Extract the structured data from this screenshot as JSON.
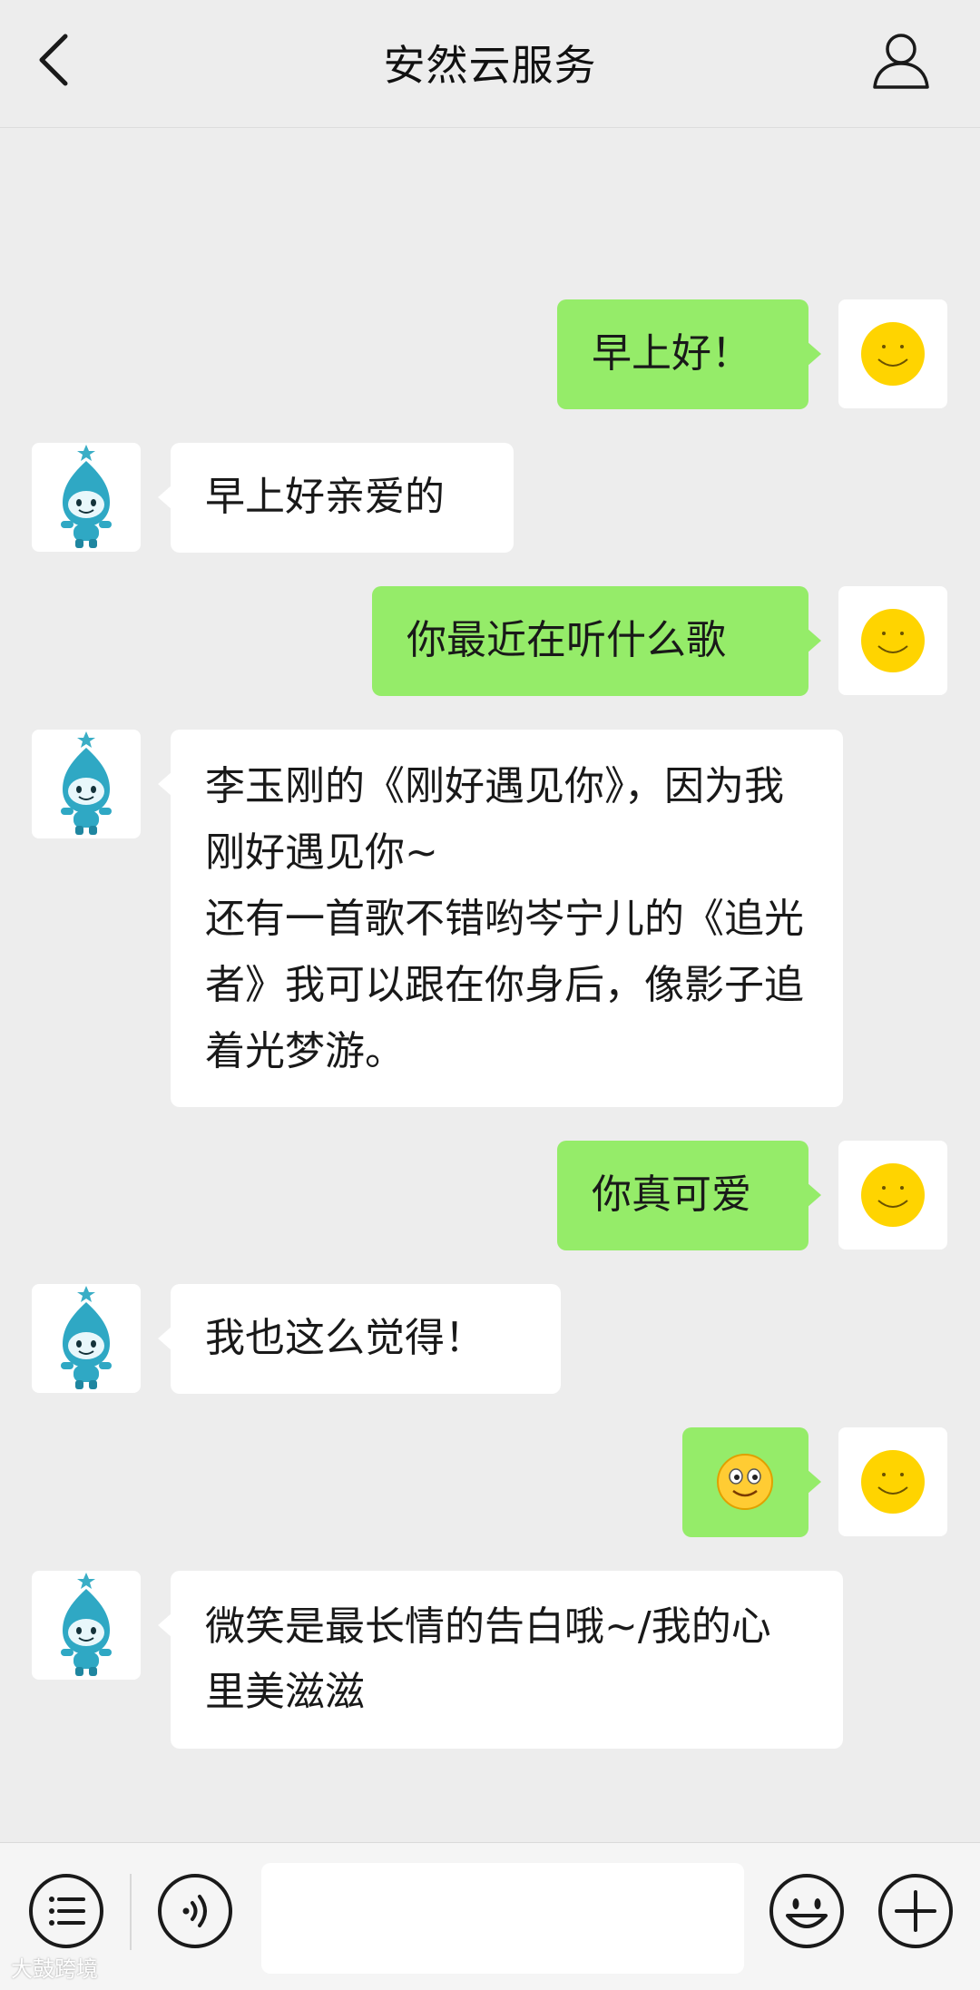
{
  "header": {
    "title": "安然云服务",
    "back_icon": "chevron-left-icon",
    "profile_icon": "user-profile-icon"
  },
  "messages": [
    {
      "side": "out",
      "text": "早上好！"
    },
    {
      "side": "in",
      "text": "早上好亲爱的"
    },
    {
      "side": "out",
      "text": "你最近在听什么歌"
    },
    {
      "side": "in",
      "text": "李玉刚的《刚好遇见你》，因为我刚好遇见你~\n还有一首歌不错哟岑宁儿的《追光者》我可以跟在你身后，像影子追着光梦游。"
    },
    {
      "side": "out",
      "text": "你真可爱"
    },
    {
      "side": "in",
      "text": "我也这么觉得！"
    },
    {
      "side": "out",
      "emoji": "smiling-face-emoji"
    },
    {
      "side": "in",
      "text": "微笑是最长情的告白哦~/我的心里美滋滋"
    }
  ],
  "input_bar": {
    "menu_icon": "list-menu-icon",
    "voice_icon": "voice-icon",
    "emoji_icon": "emoji-icon",
    "add_icon": "plus-icon",
    "placeholder": ""
  },
  "watermark": "大鼓跨境",
  "colors": {
    "background": "#ededed",
    "outgoing_bubble": "#95ec69",
    "incoming_bubble": "#ffffff",
    "user_avatar_face": "#ffd400"
  }
}
